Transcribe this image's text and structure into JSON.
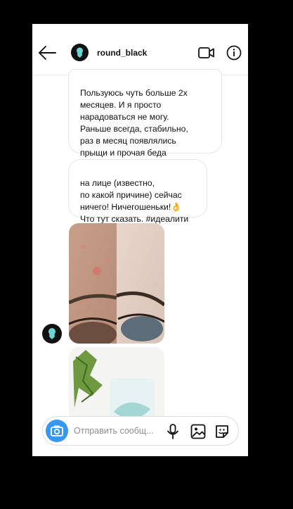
{
  "header": {
    "username": "round_black",
    "back_icon": "arrow-left-icon",
    "video_icon": "video-camera-icon",
    "info_icon": "info-circle-icon"
  },
  "messages": [
    {
      "type": "text",
      "text": "Пользуюсь чуть больше 2х\nмесяцев. И я просто\nнарадоваться не могу.\nРаньше всегда, стабильно,\nраз в месяц появлялись\nпрыщи и прочая беда"
    },
    {
      "type": "text",
      "text": "на лице (известно,\nпо какой причине) сейчас\nничего! Ничегошеньки!",
      "emoji": "👌",
      "text_end": "Что тут сказать. #идеалити"
    },
    {
      "type": "image",
      "description_icon": "before-after-photo"
    },
    {
      "type": "image",
      "description_icon": "product-photo"
    }
  ],
  "composer": {
    "placeholder": "Отправить сообщ...",
    "camera_icon": "camera-icon",
    "mic_icon": "microphone-icon",
    "gallery_icon": "gallery-icon",
    "sticker_icon": "sticker-icon"
  },
  "colors": {
    "accent": "#3897f0",
    "bubble_border": "#e6e6e6"
  }
}
